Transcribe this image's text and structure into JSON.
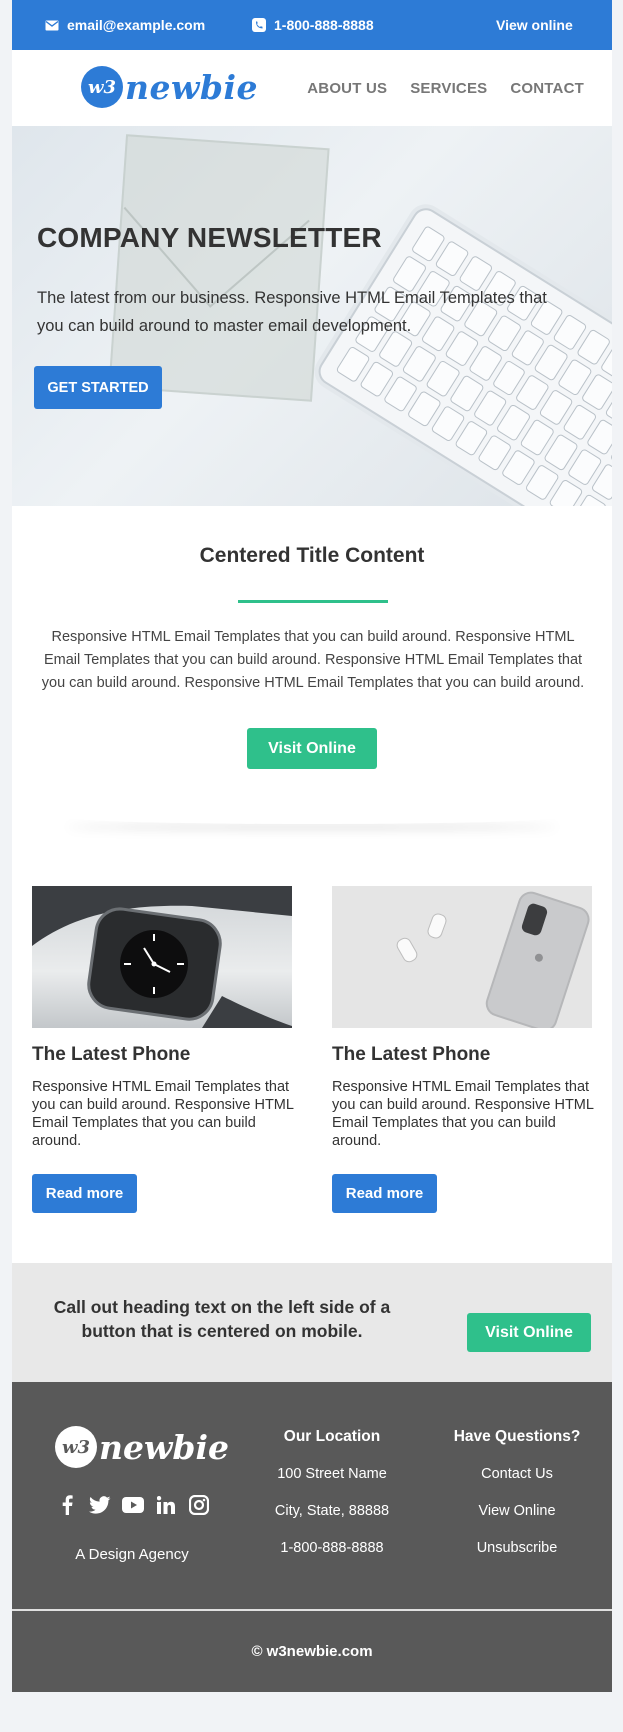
{
  "topbar": {
    "email": "email@example.com",
    "phone": "1-800-888-8888",
    "view_online": "View online"
  },
  "brand": {
    "logo_mark": "w3",
    "logo_word": "newbie"
  },
  "nav": {
    "items": [
      "ABOUT US",
      "SERVICES",
      "CONTACT"
    ]
  },
  "hero": {
    "title": "COMPANY NEWSLETTER",
    "text": "The latest from our business. Responsive HTML Email Templates that you can build around to master email development.",
    "button": "GET STARTED"
  },
  "centered": {
    "title": "Centered Title Content",
    "text": "Responsive HTML Email Templates that you can build around. Responsive HTML Email Templates that you can build around. Responsive HTML Email Templates that you can build around. Responsive HTML Email Templates that you can build around.",
    "button": "Visit Online"
  },
  "cards": [
    {
      "title": "The Latest Phone",
      "text": "Responsive HTML Email Templates that you can build around. Responsive HTML Email Templates that you can build around.",
      "button": "Read more",
      "image": "smartwatch-photo"
    },
    {
      "title": "The Latest Phone",
      "text": "Responsive HTML Email Templates that you can build around. Responsive HTML Email Templates that you can build around.",
      "button": "Read more",
      "image": "phone-and-earbuds-photo"
    }
  ],
  "callout": {
    "text": "Call out heading text on the left side of a button that is centered on mobile.",
    "button": "Visit Online"
  },
  "footer": {
    "agency": "A Design Agency",
    "social_icons": [
      "facebook-icon",
      "twitter-icon",
      "youtube-icon",
      "linkedin-icon",
      "instagram-icon"
    ],
    "location": {
      "heading": "Our Location",
      "lines": [
        "100 Street Name",
        "City, State, 88888",
        "1-800-888-8888"
      ]
    },
    "questions": {
      "heading": "Have Questions?",
      "links": [
        "Contact Us",
        "View Online",
        "Unsubscribe"
      ]
    },
    "copyright": "© w3newbie.com"
  },
  "colors": {
    "primary_blue": "#2d7bd6",
    "accent_green": "#2fc08b",
    "footer_gray": "#595959",
    "callout_gray": "#e8e8e8"
  }
}
